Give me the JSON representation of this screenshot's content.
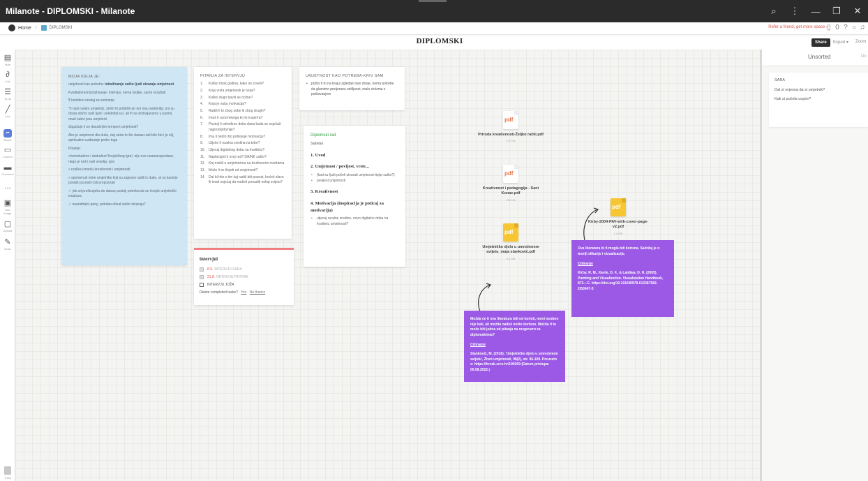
{
  "window": {
    "title": "Milanote - DIPLOMSKI - Milanote"
  },
  "breadcrumb": {
    "home": "Home",
    "current": "DIPLOMSKI"
  },
  "topbar": {
    "refer": "Refer a friend, get more space ›",
    "count": "0"
  },
  "board": {
    "title": "DIPLOMSKI",
    "share": "Share",
    "export": "Export ▾",
    "zoom": "Zoom"
  },
  "toolbar": {
    "items": [
      {
        "label": "Note",
        "icon": "note-icon"
      },
      {
        "label": "Link",
        "icon": "link-icon"
      },
      {
        "label": "To-do",
        "icon": "todo-icon"
      },
      {
        "label": "Line",
        "icon": "line-icon"
      },
      {
        "label": "Board",
        "icon": "board-icon"
      },
      {
        "label": "Column",
        "icon": "column-icon"
      },
      {
        "label": "Comment",
        "icon": "comment-icon"
      },
      {
        "label": "...",
        "icon": "more-icon"
      },
      {
        "label": "Add image",
        "icon": "image-icon"
      },
      {
        "label": "Upload",
        "icon": "upload-icon"
      },
      {
        "label": "Draw",
        "icon": "draw-icon"
      }
    ],
    "trash": "Trash"
  },
  "rightpanel": {
    "unsorted": "Unsorted",
    "other": "Do",
    "card": {
      "title": "SARA",
      "q1": "Dal si svjesna da si umjetnik?",
      "q2": "Kak si počela uopće?"
    }
  },
  "ideja": {
    "heading": "MOJA IDEJA JE:",
    "p1_plain": "umjetnost kao potreba: ",
    "p1_bold": "istraživanje zašto ljudi stvaraju umjetnost",
    "p2": "Kvalitativno/nistraživanje- intervjui, nema brojke, samo rezultati",
    "p3": "¶ kontiteni uredaj za snimanje",
    "p4": "*ti naši ruralni umjetnici, želim ih približiti jer oni nisu selebritiji, oni su dosta obični naši ljudi i selebritiji su!, ali ih ne doživljavamo u punini, onak kakvi jesu umjetnici",
    "p5": "Zagušuje li se današnjim tempom umjetnost?",
    "p6": "Ako je umjetnost dio duše, daj onda to što danas radi bilo što i je cilj, spiritualno uzdizanje preko toga",
    "p7": "Pisanje:",
    "p8": "»homoludens i deduders*čovjek/bog igra!, nije ove usamasepodase, nego je neš i radi veselja, igre",
    "p9": "» razlika izmedu kreativnost i umjetnosti",
    "p10": "» spomenuti neke umjetnike koji su zapravo radili iz duše, al su kasnije postali poznati i bili prepoznati",
    "p11": "✓ jok od prečicojeka do danas postoji potreba da se čovjek umjetnički izražava",
    "p12": "✓ neandrtalci-pony, potreba otkud zašto stvaraju?"
  },
  "pitanja": {
    "heading": "PITANJA ZA INTERVJU",
    "items": [
      "Koliko imaš godina, kako se zoveš?",
      "Koja vrsta umjetnosti je tvoja?",
      "Koliko dugo baviš se ocime?",
      "Koja je vaša motivacija?",
      "Radiš li to zbog sebe ili zbog drugih?",
      "Imaš li uzor/nekoga ko te inspirira?",
      "Postoji li određeno doba dana kada se osjećaš najproduktivnije?",
      "Ima li nešto što potiskuje motivaciju?",
      "Utječe li ruralna sredina na tebe?",
      "Utjecaj digitalnog doba na kvalitetu?",
      "Naplaćuješ li svoj rad? DA/NE zašto?",
      "Kaj misliš o umjetnicima na društvenim mrežama",
      "Može li se živjeti od umjetnosti?",
      "Dal bi htio s tim kaj radiš biti poznat, hoćeš slavu ili imaš osjećaj da možeš ponuditi nekaj svijetu?"
    ]
  },
  "umjetnost": {
    "heading": "UMJETNOST KAO POTREBA-KRIV SAM",
    "bullet": "pošto ti to na kraju izgledalo kao dosje, nema potrebe da glumimo pretjeranu oztiljnost, malo cinizma s poštovanjem"
  },
  "diplomski": {
    "green": "Diplomski rad",
    "sazetak": "Sažetak",
    "h1": "1. Uvod",
    "h2": "2. Umjetnost / povijest, vrste...",
    "b1": "(kad su ljudi počeli stvarati umjetnost-tipije-zašto?)",
    "b2": "povijest umjetnosti",
    "h3": "3. Kreativnost",
    "h4": "4. Motivacija (inspiracija je poticaj za motivaciju)",
    "b3": "utjecaj ruralne sredine, novo digitalno doba na kvalitetu umjetnosti?"
  },
  "intervjui": {
    "title": "intervjui",
    "tasks": [
      {
        "date": "8.9.",
        "text": "INTERVJU SARA"
      },
      {
        "date": "21.8.",
        "text": "INTERVJU PETRAK"
      },
      {
        "date": "",
        "text": "INTERVJU JOŽA"
      }
    ],
    "delete_q": "Delete completed tasks?",
    "yes": "Yes",
    "no": "No thanks"
  },
  "pdfs": [
    {
      "name": "Priroda kreativnosti-Željko rački.pdf",
      "size": "127 KB",
      "tag": "pdf"
    },
    {
      "name": "Kreativnost i pedagogija - Sani Kunac.pdf",
      "size": "232 KB",
      "tag": "pdf"
    },
    {
      "name": "Umjetničko djelo u umreženom svijetu_maja stanković.pdf",
      "size": "3.1 MB",
      "tag": "pdf"
    },
    {
      "name": "Kirby-2004-PAV-with-cover-page-v2.pdf",
      "size": "1.6 MB",
      "tag": "pdf"
    }
  ],
  "note1": {
    "text": "Možda će ti ova literatura biti od koristi, meni osobno nije bali, ali možda nađeš nešto korisno. Možda ti to može biti jedna od pitanja na razgovoru za diplomskiima?",
    "citiranje": "Citiranje",
    "ref": "Stanković, M. (2016). 'Umjetničko djelo u umreženom svijetu', Život umjetnosti, 98(2), str. 96-109. Preuzeto s: https://hrcak.srce.hr/190269 (Datum pristupa: 05.08.2022.)"
  },
  "note2": {
    "text": "Ova literatura bi ti mogla biti korisna. Sadržaj je o teoriji slikarije i vizualizacije.",
    "citiranje": "Citiranje",
    "ref": "Kirby, R. M., Keefe, D. F., & Laidlaw, D. H. (2005). Painting and Visualization. Visualization Handbook, 873—C. https://doi.org/10.1016/B978-012387582-2/50047-3"
  }
}
